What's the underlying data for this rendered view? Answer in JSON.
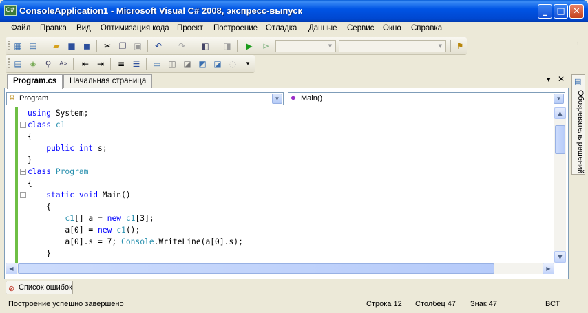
{
  "window": {
    "title": "ConsoleApplication1 - Microsoft Visual C# 2008, экспресс-выпуск",
    "minimize": "_",
    "maximize": "□",
    "close": "✕"
  },
  "menu": [
    "Файл",
    "Правка",
    "Вид",
    "Оптимизация кода",
    "Проект",
    "Построение",
    "Отладка",
    "Данные",
    "Сервис",
    "Окно",
    "Справка"
  ],
  "tabs": {
    "active": "Program.cs",
    "inactive": "Начальная страница",
    "pin": "▾",
    "close": "✕"
  },
  "nav": {
    "class_combo": "Program",
    "member_combo": "Main()"
  },
  "code": [
    [
      {
        "t": "using System;",
        "c": "kw0"
      }
    ],
    [
      {
        "t": "class ",
        "c": "kw"
      },
      {
        "t": "c1",
        "c": "ty"
      }
    ],
    [
      {
        "t": "{",
        "c": ""
      }
    ],
    [
      {
        "t": "    public ",
        "c": "kw"
      },
      {
        "t": "int ",
        "c": "kw"
      },
      {
        "t": "s;",
        "c": ""
      }
    ],
    [
      {
        "t": "}",
        "c": ""
      }
    ],
    [
      {
        "t": "class ",
        "c": "kw"
      },
      {
        "t": "Program",
        "c": "ty"
      }
    ],
    [
      {
        "t": "{",
        "c": ""
      }
    ],
    [
      {
        "t": "    static ",
        "c": "kw"
      },
      {
        "t": "void ",
        "c": "kw"
      },
      {
        "t": "Main()",
        "c": ""
      }
    ],
    [
      {
        "t": "    {",
        "c": ""
      }
    ],
    [
      {
        "t": "        ",
        "c": ""
      },
      {
        "t": "c1",
        "c": "ty"
      },
      {
        "t": "[] a = ",
        "c": ""
      },
      {
        "t": "new ",
        "c": "kw"
      },
      {
        "t": "c1",
        "c": "ty"
      },
      {
        "t": "[3];",
        "c": ""
      }
    ],
    [
      {
        "t": "        a[0] = ",
        "c": ""
      },
      {
        "t": "new ",
        "c": "kw"
      },
      {
        "t": "c1",
        "c": "ty"
      },
      {
        "t": "();",
        "c": ""
      }
    ],
    [
      {
        "t": "        a[0].s = 7; ",
        "c": ""
      },
      {
        "t": "Console",
        "c": "ty"
      },
      {
        "t": ".WriteLine(a[0].s);",
        "c": ""
      }
    ],
    [
      {
        "t": "    }",
        "c": ""
      }
    ]
  ],
  "side_panel": {
    "label": "Обозреватель решений"
  },
  "error_list": {
    "label": "Список ошибок"
  },
  "status": {
    "message": "Построение успешно завершено",
    "line": "Строка 12",
    "column": "Столбец 47",
    "char": "Знак 47",
    "mode": "ВСТ"
  }
}
